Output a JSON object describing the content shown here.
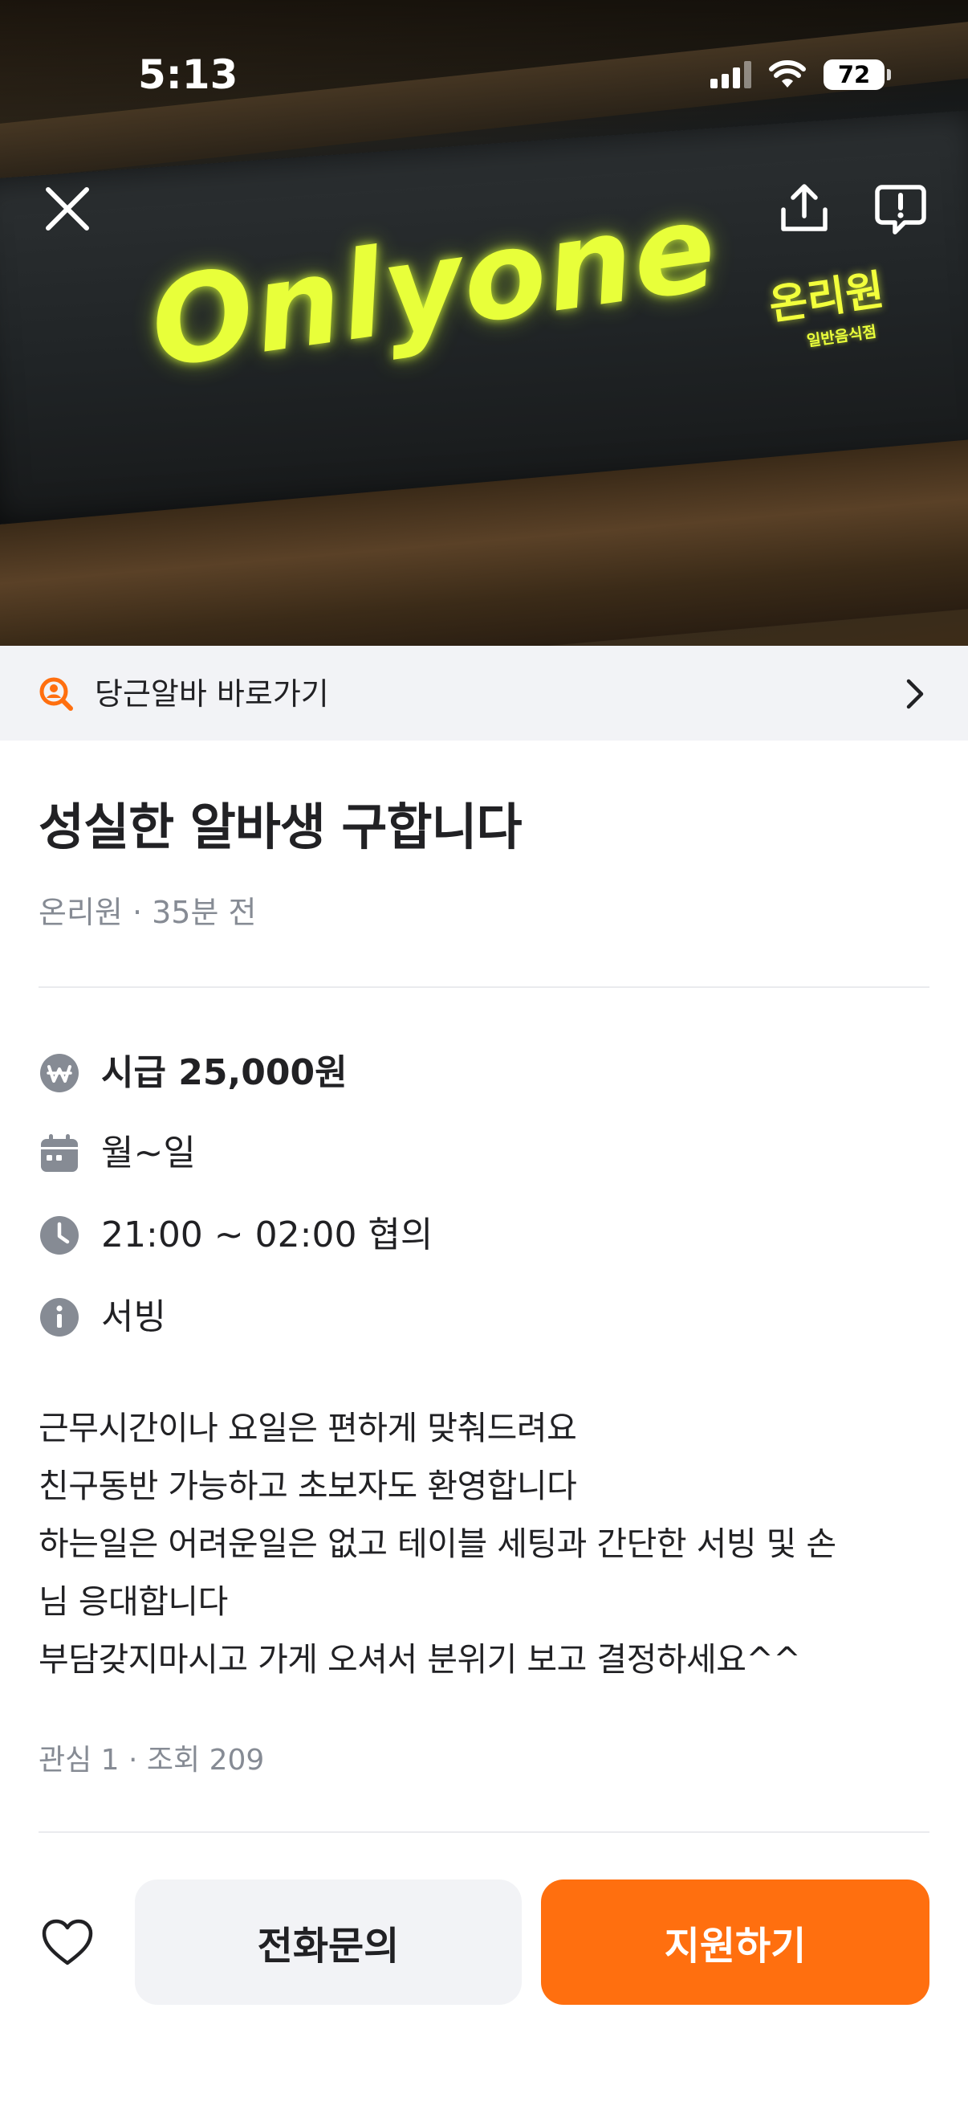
{
  "status_bar": {
    "time": "5:13",
    "battery": "72",
    "icons": [
      "cellular-signal-icon",
      "wifi-icon",
      "battery-icon"
    ]
  },
  "hero": {
    "sign_logo": "Onlyone",
    "sign_korean": "온리원",
    "sign_korean_sub": "일반음식점",
    "buttons": [
      "close-icon",
      "share-icon",
      "report-icon"
    ]
  },
  "shortcut": {
    "label": "당근알바 바로가기",
    "icon": "search-person-icon",
    "accent": "#ff6f0f"
  },
  "post": {
    "title": "성실한 알바생 구합니다",
    "meta": "온리원 · 35분 전",
    "wage": "시급 25,000원",
    "days": "월~일",
    "hours": "21:00 ~ 02:00 협의",
    "job": "서빙",
    "description": [
      "근무시간이나 요일은 편하게 맞춰드려요",
      "친구동반 가능하고 초보자도 환영합니다",
      "하는일은 어려운일은 없고 테이블 세팅과 간단한 서빙 및 손",
      "님 응대합니다",
      "부담갖지마시고 가게 오셔서 분위기 보고 결정하세요^^"
    ],
    "stats": "관심 1 · 조회 209"
  },
  "actions": {
    "call_label": "전화문의",
    "apply_label": "지원하기",
    "apply_color": "#ff6f0f"
  }
}
